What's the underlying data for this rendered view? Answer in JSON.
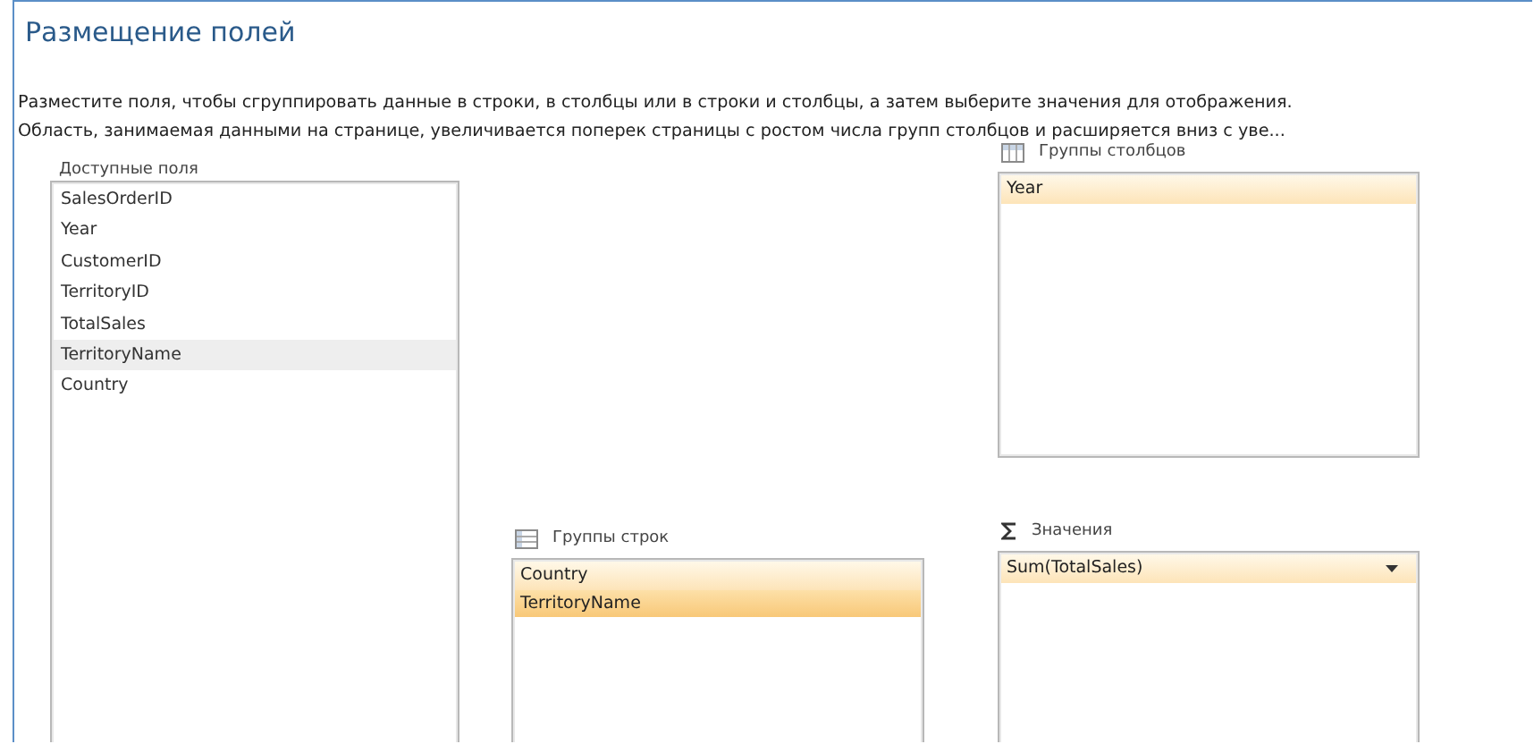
{
  "title": "Размещение полей",
  "description": [
    "Разместите поля, чтобы сгруппировать данные в строки, в столбцы или в строки и столбцы, а затем выберите значения для отображения.",
    "Область, занимаемая данными на странице, увеличивается поперек страницы с ростом числа групп столбцов и расширяется вниз с уве..."
  ],
  "available_fields": {
    "label": "Доступные поля",
    "items": [
      {
        "name": "SalesOrderID",
        "selected": false
      },
      {
        "name": "Year",
        "selected": false
      },
      {
        "name": "CustomerID",
        "selected": false
      },
      {
        "name": "TerritoryID",
        "selected": false
      },
      {
        "name": "TotalSales",
        "selected": false
      },
      {
        "name": "TerritoryName",
        "selected": true
      },
      {
        "name": "Country",
        "selected": false
      }
    ]
  },
  "column_groups": {
    "label": "Группы столбцов",
    "items": [
      {
        "name": "Year",
        "selected": false
      }
    ]
  },
  "row_groups": {
    "label": "Группы строк",
    "items": [
      {
        "name": "Country",
        "selected": false
      },
      {
        "name": "TerritoryName",
        "selected": true
      }
    ]
  },
  "values": {
    "label": "Значения",
    "items": [
      {
        "name": "Sum(TotalSales)",
        "selected": false
      }
    ]
  }
}
